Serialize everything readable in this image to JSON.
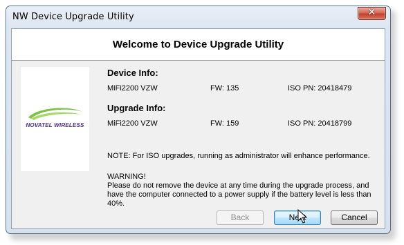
{
  "window": {
    "title": "NW Device Upgrade Utility",
    "close_glyph": "✕"
  },
  "header": {
    "title": "Welcome to Device Upgrade Utility"
  },
  "logo": {
    "text": "NOVATEL WIRELESS",
    "swoosh_color": "#7dc242",
    "text_color": "#4b2a8c"
  },
  "device_info": {
    "heading": "Device Info:",
    "model": "MiFi2200 VZW",
    "fw": "FW: 135",
    "iso_pn": "ISO PN: 20418479"
  },
  "upgrade_info": {
    "heading": "Upgrade Info:",
    "model": "MiFi2200 VZW",
    "fw": "FW: 159",
    "iso_pn": "ISO PN: 20418799"
  },
  "note": "NOTE: For ISO upgrades, running as administrator will enhance performance.",
  "warning": {
    "title": "WARNING!",
    "line1": "Please do not remove the device at any time during the upgrade process, and",
    "line2": "have the computer connected to a power supply if the battery level is less than 40%."
  },
  "buttons": {
    "back": "Back",
    "next": "Next",
    "cancel": "Cancel"
  }
}
